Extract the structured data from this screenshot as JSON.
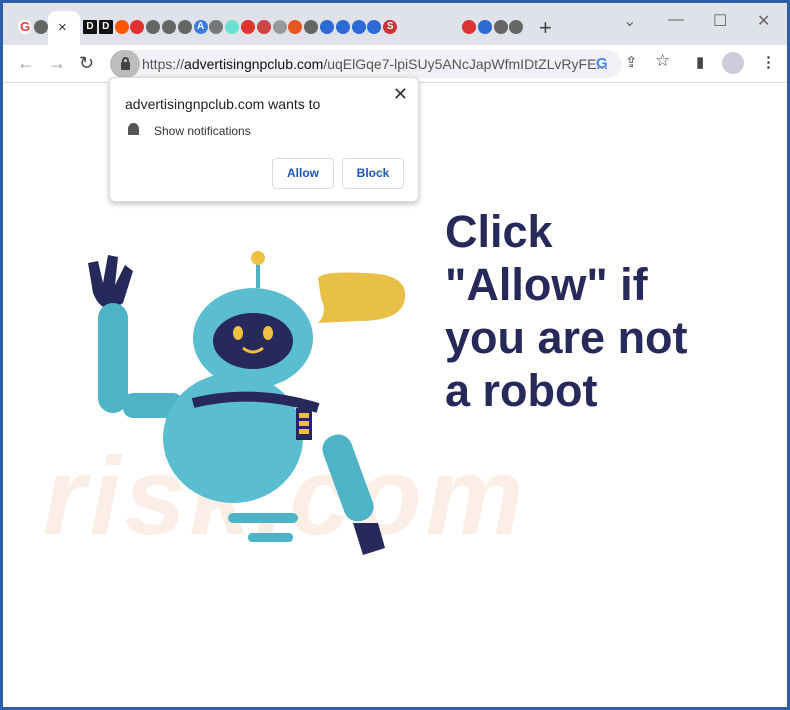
{
  "tabs": {
    "favicons": [
      {
        "icon": "google-icon",
        "color": "#ea4335",
        "t": "G"
      },
      {
        "icon": "globe-icon",
        "color": "#666",
        "t": ""
      },
      {
        "icon": "d-icon",
        "color": "#111",
        "t": "D"
      },
      {
        "icon": "d-icon",
        "color": "#111",
        "t": "D"
      },
      {
        "icon": "reddit-icon",
        "color": "#ff5700",
        "t": ""
      },
      {
        "icon": "shield-icon",
        "color": "#d33",
        "t": ""
      },
      {
        "icon": "globe-icon",
        "color": "#666",
        "t": ""
      },
      {
        "icon": "globe-icon",
        "color": "#666",
        "t": ""
      },
      {
        "icon": "globe-icon",
        "color": "#666",
        "t": ""
      },
      {
        "icon": "a-icon",
        "color": "#3d7be0",
        "t": "A"
      },
      {
        "icon": "robot-icon",
        "color": "#777",
        "t": ""
      },
      {
        "icon": "e-icon",
        "color": "#6ee0cf",
        "t": ""
      },
      {
        "icon": "shield-icon",
        "color": "#d33",
        "t": ""
      },
      {
        "icon": "shield-icon",
        "color": "#c44",
        "t": ""
      },
      {
        "icon": "ec-icon",
        "color": "#999",
        "t": ""
      },
      {
        "icon": "ubuntu-icon",
        "color": "#e95420",
        "t": ""
      },
      {
        "icon": "globe-icon",
        "color": "#666",
        "t": ""
      },
      {
        "icon": "edge-icon",
        "color": "#2d6ad3",
        "t": ""
      },
      {
        "icon": "edge-icon",
        "color": "#2d6ad3",
        "t": ""
      },
      {
        "icon": "edge-icon",
        "color": "#2d6ad3",
        "t": ""
      },
      {
        "icon": "edge-icon",
        "color": "#2d6ad3",
        "t": ""
      },
      {
        "icon": "s-icon",
        "color": "#c33",
        "t": "S"
      },
      {
        "icon": "red-icon",
        "color": "#d33",
        "t": ""
      },
      {
        "icon": "edge-icon",
        "color": "#2d6ad3",
        "t": ""
      },
      {
        "icon": "globe-icon",
        "color": "#666",
        "t": ""
      },
      {
        "icon": "globe-icon",
        "color": "#666",
        "t": ""
      }
    ],
    "close": "×",
    "new_tab": "+"
  },
  "window": {
    "minimize": "—",
    "maximize": "☐",
    "close": "✕",
    "dropdown": "⌄"
  },
  "toolbar": {
    "back": "←",
    "forward": "→",
    "reload": "↻",
    "url_scheme": "https://",
    "url_host": "advertisingnpclub.com",
    "url_path": "/uqElGqe7-lpiSUy5ANcJapWfmIDtZLvRyFE...",
    "google": "G",
    "share": "⇪",
    "star": "☆",
    "sidepanel": "▮",
    "menu": "⋮"
  },
  "popup": {
    "title": "advertisingnpclub.com wants to",
    "permission": "Show notifications",
    "allow": "Allow",
    "block": "Block",
    "close": "✕"
  },
  "page": {
    "headline_lines": [
      "Click",
      "\"Allow\" if",
      "you are not",
      "a robot"
    ],
    "headline_color": "#27295a"
  }
}
